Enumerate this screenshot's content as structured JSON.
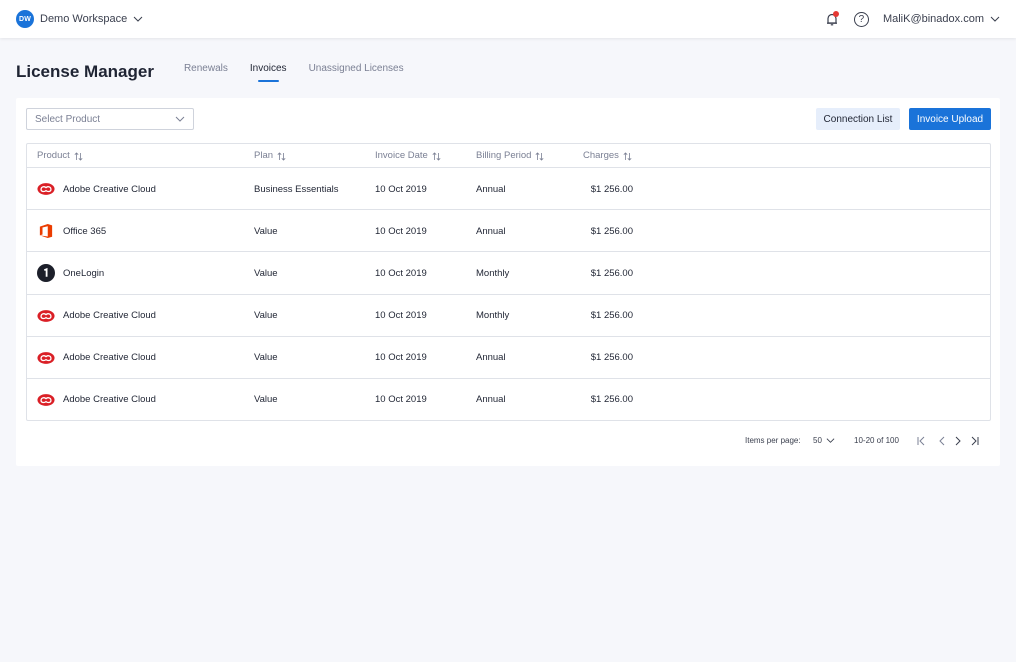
{
  "topbar": {
    "workspace_initials": "DW",
    "workspace_name": "Demo Workspace",
    "user_email": "MaliK@binadox.com",
    "help_glyph": "?"
  },
  "page": {
    "title": "License Manager",
    "tabs": [
      {
        "label": "Renewals",
        "active": false
      },
      {
        "label": "Invoices",
        "active": true
      },
      {
        "label": "Unassigned Licenses",
        "active": false
      }
    ]
  },
  "toolbar": {
    "select_placeholder": "Select Product",
    "connection_list_label": "Connection List",
    "invoice_upload_label": "Invoice Upload"
  },
  "table": {
    "columns": [
      "Product",
      "Plan",
      "Invoice Date",
      "Billing Period",
      "Charges"
    ],
    "rows": [
      {
        "icon": "adobe-creative-cloud-icon",
        "product": "Adobe Creative Cloud",
        "plan": "Business Essentials",
        "date": "10 Oct 2019",
        "period": "Annual",
        "charges": "$1 256.00"
      },
      {
        "icon": "office-365-icon",
        "product": "Office 365",
        "plan": "Value",
        "date": "10 Oct 2019",
        "period": "Annual",
        "charges": "$1 256.00"
      },
      {
        "icon": "onelogin-icon",
        "product": "OneLogin",
        "plan": "Value",
        "date": "10 Oct 2019",
        "period": "Monthly",
        "charges": "$1 256.00"
      },
      {
        "icon": "adobe-creative-cloud-icon",
        "product": "Adobe Creative Cloud",
        "plan": "Value",
        "date": "10 Oct 2019",
        "period": "Monthly",
        "charges": "$1 256.00"
      },
      {
        "icon": "adobe-creative-cloud-icon",
        "product": "Adobe Creative Cloud",
        "plan": "Value",
        "date": "10 Oct 2019",
        "period": "Annual",
        "charges": "$1 256.00"
      },
      {
        "icon": "adobe-creative-cloud-icon",
        "product": "Adobe Creative Cloud",
        "plan": "Value",
        "date": "10 Oct 2019",
        "period": "Annual",
        "charges": "$1 256.00"
      }
    ]
  },
  "pagination": {
    "items_per_page_label": "Items per page:",
    "items_per_page": "50",
    "range": "10-20 of 100"
  },
  "colors": {
    "accent": "#1a73d9",
    "background": "#f6f7fb",
    "notification_dot": "#e53935",
    "adobe_red": "#da1f26",
    "office_orange": "#eb3c00",
    "onelogin_dark": "#1c1f2a"
  }
}
